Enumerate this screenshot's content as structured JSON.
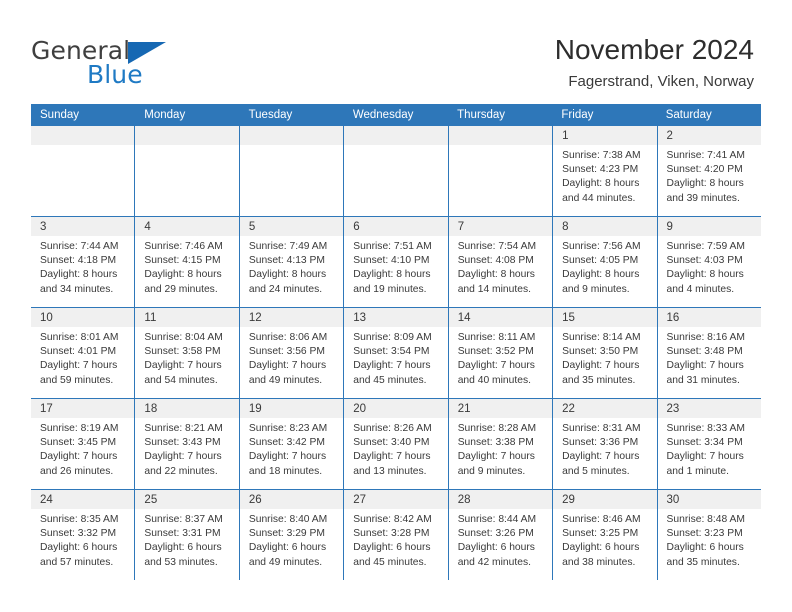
{
  "brand": {
    "word_one": "General",
    "word_two": "Blue",
    "flag_icon": "triangle-flag-icon"
  },
  "header": {
    "title": "November 2024",
    "location": "Fagerstrand, Viken, Norway"
  },
  "colors": {
    "header_blue": "#2e77b9",
    "brand_blue": "#1f7ac4",
    "daynum_band": "#f0f0f0",
    "text": "#3a3a3a"
  },
  "weekdays": [
    "Sunday",
    "Monday",
    "Tuesday",
    "Wednesday",
    "Thursday",
    "Friday",
    "Saturday"
  ],
  "weeks": [
    [
      {
        "day": "",
        "empty": true
      },
      {
        "day": "",
        "empty": true
      },
      {
        "day": "",
        "empty": true
      },
      {
        "day": "",
        "empty": true
      },
      {
        "day": "",
        "empty": true
      },
      {
        "day": "1",
        "sunrise": "Sunrise: 7:38 AM",
        "sunset": "Sunset: 4:23 PM",
        "daylight_1": "Daylight: 8 hours",
        "daylight_2": "and 44 minutes."
      },
      {
        "day": "2",
        "sunrise": "Sunrise: 7:41 AM",
        "sunset": "Sunset: 4:20 PM",
        "daylight_1": "Daylight: 8 hours",
        "daylight_2": "and 39 minutes."
      }
    ],
    [
      {
        "day": "3",
        "sunrise": "Sunrise: 7:44 AM",
        "sunset": "Sunset: 4:18 PM",
        "daylight_1": "Daylight: 8 hours",
        "daylight_2": "and 34 minutes."
      },
      {
        "day": "4",
        "sunrise": "Sunrise: 7:46 AM",
        "sunset": "Sunset: 4:15 PM",
        "daylight_1": "Daylight: 8 hours",
        "daylight_2": "and 29 minutes."
      },
      {
        "day": "5",
        "sunrise": "Sunrise: 7:49 AM",
        "sunset": "Sunset: 4:13 PM",
        "daylight_1": "Daylight: 8 hours",
        "daylight_2": "and 24 minutes."
      },
      {
        "day": "6",
        "sunrise": "Sunrise: 7:51 AM",
        "sunset": "Sunset: 4:10 PM",
        "daylight_1": "Daylight: 8 hours",
        "daylight_2": "and 19 minutes."
      },
      {
        "day": "7",
        "sunrise": "Sunrise: 7:54 AM",
        "sunset": "Sunset: 4:08 PM",
        "daylight_1": "Daylight: 8 hours",
        "daylight_2": "and 14 minutes."
      },
      {
        "day": "8",
        "sunrise": "Sunrise: 7:56 AM",
        "sunset": "Sunset: 4:05 PM",
        "daylight_1": "Daylight: 8 hours",
        "daylight_2": "and 9 minutes."
      },
      {
        "day": "9",
        "sunrise": "Sunrise: 7:59 AM",
        "sunset": "Sunset: 4:03 PM",
        "daylight_1": "Daylight: 8 hours",
        "daylight_2": "and 4 minutes."
      }
    ],
    [
      {
        "day": "10",
        "sunrise": "Sunrise: 8:01 AM",
        "sunset": "Sunset: 4:01 PM",
        "daylight_1": "Daylight: 7 hours",
        "daylight_2": "and 59 minutes."
      },
      {
        "day": "11",
        "sunrise": "Sunrise: 8:04 AM",
        "sunset": "Sunset: 3:58 PM",
        "daylight_1": "Daylight: 7 hours",
        "daylight_2": "and 54 minutes."
      },
      {
        "day": "12",
        "sunrise": "Sunrise: 8:06 AM",
        "sunset": "Sunset: 3:56 PM",
        "daylight_1": "Daylight: 7 hours",
        "daylight_2": "and 49 minutes."
      },
      {
        "day": "13",
        "sunrise": "Sunrise: 8:09 AM",
        "sunset": "Sunset: 3:54 PM",
        "daylight_1": "Daylight: 7 hours",
        "daylight_2": "and 45 minutes."
      },
      {
        "day": "14",
        "sunrise": "Sunrise: 8:11 AM",
        "sunset": "Sunset: 3:52 PM",
        "daylight_1": "Daylight: 7 hours",
        "daylight_2": "and 40 minutes."
      },
      {
        "day": "15",
        "sunrise": "Sunrise: 8:14 AM",
        "sunset": "Sunset: 3:50 PM",
        "daylight_1": "Daylight: 7 hours",
        "daylight_2": "and 35 minutes."
      },
      {
        "day": "16",
        "sunrise": "Sunrise: 8:16 AM",
        "sunset": "Sunset: 3:48 PM",
        "daylight_1": "Daylight: 7 hours",
        "daylight_2": "and 31 minutes."
      }
    ],
    [
      {
        "day": "17",
        "sunrise": "Sunrise: 8:19 AM",
        "sunset": "Sunset: 3:45 PM",
        "daylight_1": "Daylight: 7 hours",
        "daylight_2": "and 26 minutes."
      },
      {
        "day": "18",
        "sunrise": "Sunrise: 8:21 AM",
        "sunset": "Sunset: 3:43 PM",
        "daylight_1": "Daylight: 7 hours",
        "daylight_2": "and 22 minutes."
      },
      {
        "day": "19",
        "sunrise": "Sunrise: 8:23 AM",
        "sunset": "Sunset: 3:42 PM",
        "daylight_1": "Daylight: 7 hours",
        "daylight_2": "and 18 minutes."
      },
      {
        "day": "20",
        "sunrise": "Sunrise: 8:26 AM",
        "sunset": "Sunset: 3:40 PM",
        "daylight_1": "Daylight: 7 hours",
        "daylight_2": "and 13 minutes."
      },
      {
        "day": "21",
        "sunrise": "Sunrise: 8:28 AM",
        "sunset": "Sunset: 3:38 PM",
        "daylight_1": "Daylight: 7 hours",
        "daylight_2": "and 9 minutes."
      },
      {
        "day": "22",
        "sunrise": "Sunrise: 8:31 AM",
        "sunset": "Sunset: 3:36 PM",
        "daylight_1": "Daylight: 7 hours",
        "daylight_2": "and 5 minutes."
      },
      {
        "day": "23",
        "sunrise": "Sunrise: 8:33 AM",
        "sunset": "Sunset: 3:34 PM",
        "daylight_1": "Daylight: 7 hours",
        "daylight_2": "and 1 minute."
      }
    ],
    [
      {
        "day": "24",
        "sunrise": "Sunrise: 8:35 AM",
        "sunset": "Sunset: 3:32 PM",
        "daylight_1": "Daylight: 6 hours",
        "daylight_2": "and 57 minutes."
      },
      {
        "day": "25",
        "sunrise": "Sunrise: 8:37 AM",
        "sunset": "Sunset: 3:31 PM",
        "daylight_1": "Daylight: 6 hours",
        "daylight_2": "and 53 minutes."
      },
      {
        "day": "26",
        "sunrise": "Sunrise: 8:40 AM",
        "sunset": "Sunset: 3:29 PM",
        "daylight_1": "Daylight: 6 hours",
        "daylight_2": "and 49 minutes."
      },
      {
        "day": "27",
        "sunrise": "Sunrise: 8:42 AM",
        "sunset": "Sunset: 3:28 PM",
        "daylight_1": "Daylight: 6 hours",
        "daylight_2": "and 45 minutes."
      },
      {
        "day": "28",
        "sunrise": "Sunrise: 8:44 AM",
        "sunset": "Sunset: 3:26 PM",
        "daylight_1": "Daylight: 6 hours",
        "daylight_2": "and 42 minutes."
      },
      {
        "day": "29",
        "sunrise": "Sunrise: 8:46 AM",
        "sunset": "Sunset: 3:25 PM",
        "daylight_1": "Daylight: 6 hours",
        "daylight_2": "and 38 minutes."
      },
      {
        "day": "30",
        "sunrise": "Sunrise: 8:48 AM",
        "sunset": "Sunset: 3:23 PM",
        "daylight_1": "Daylight: 6 hours",
        "daylight_2": "and 35 minutes."
      }
    ]
  ]
}
